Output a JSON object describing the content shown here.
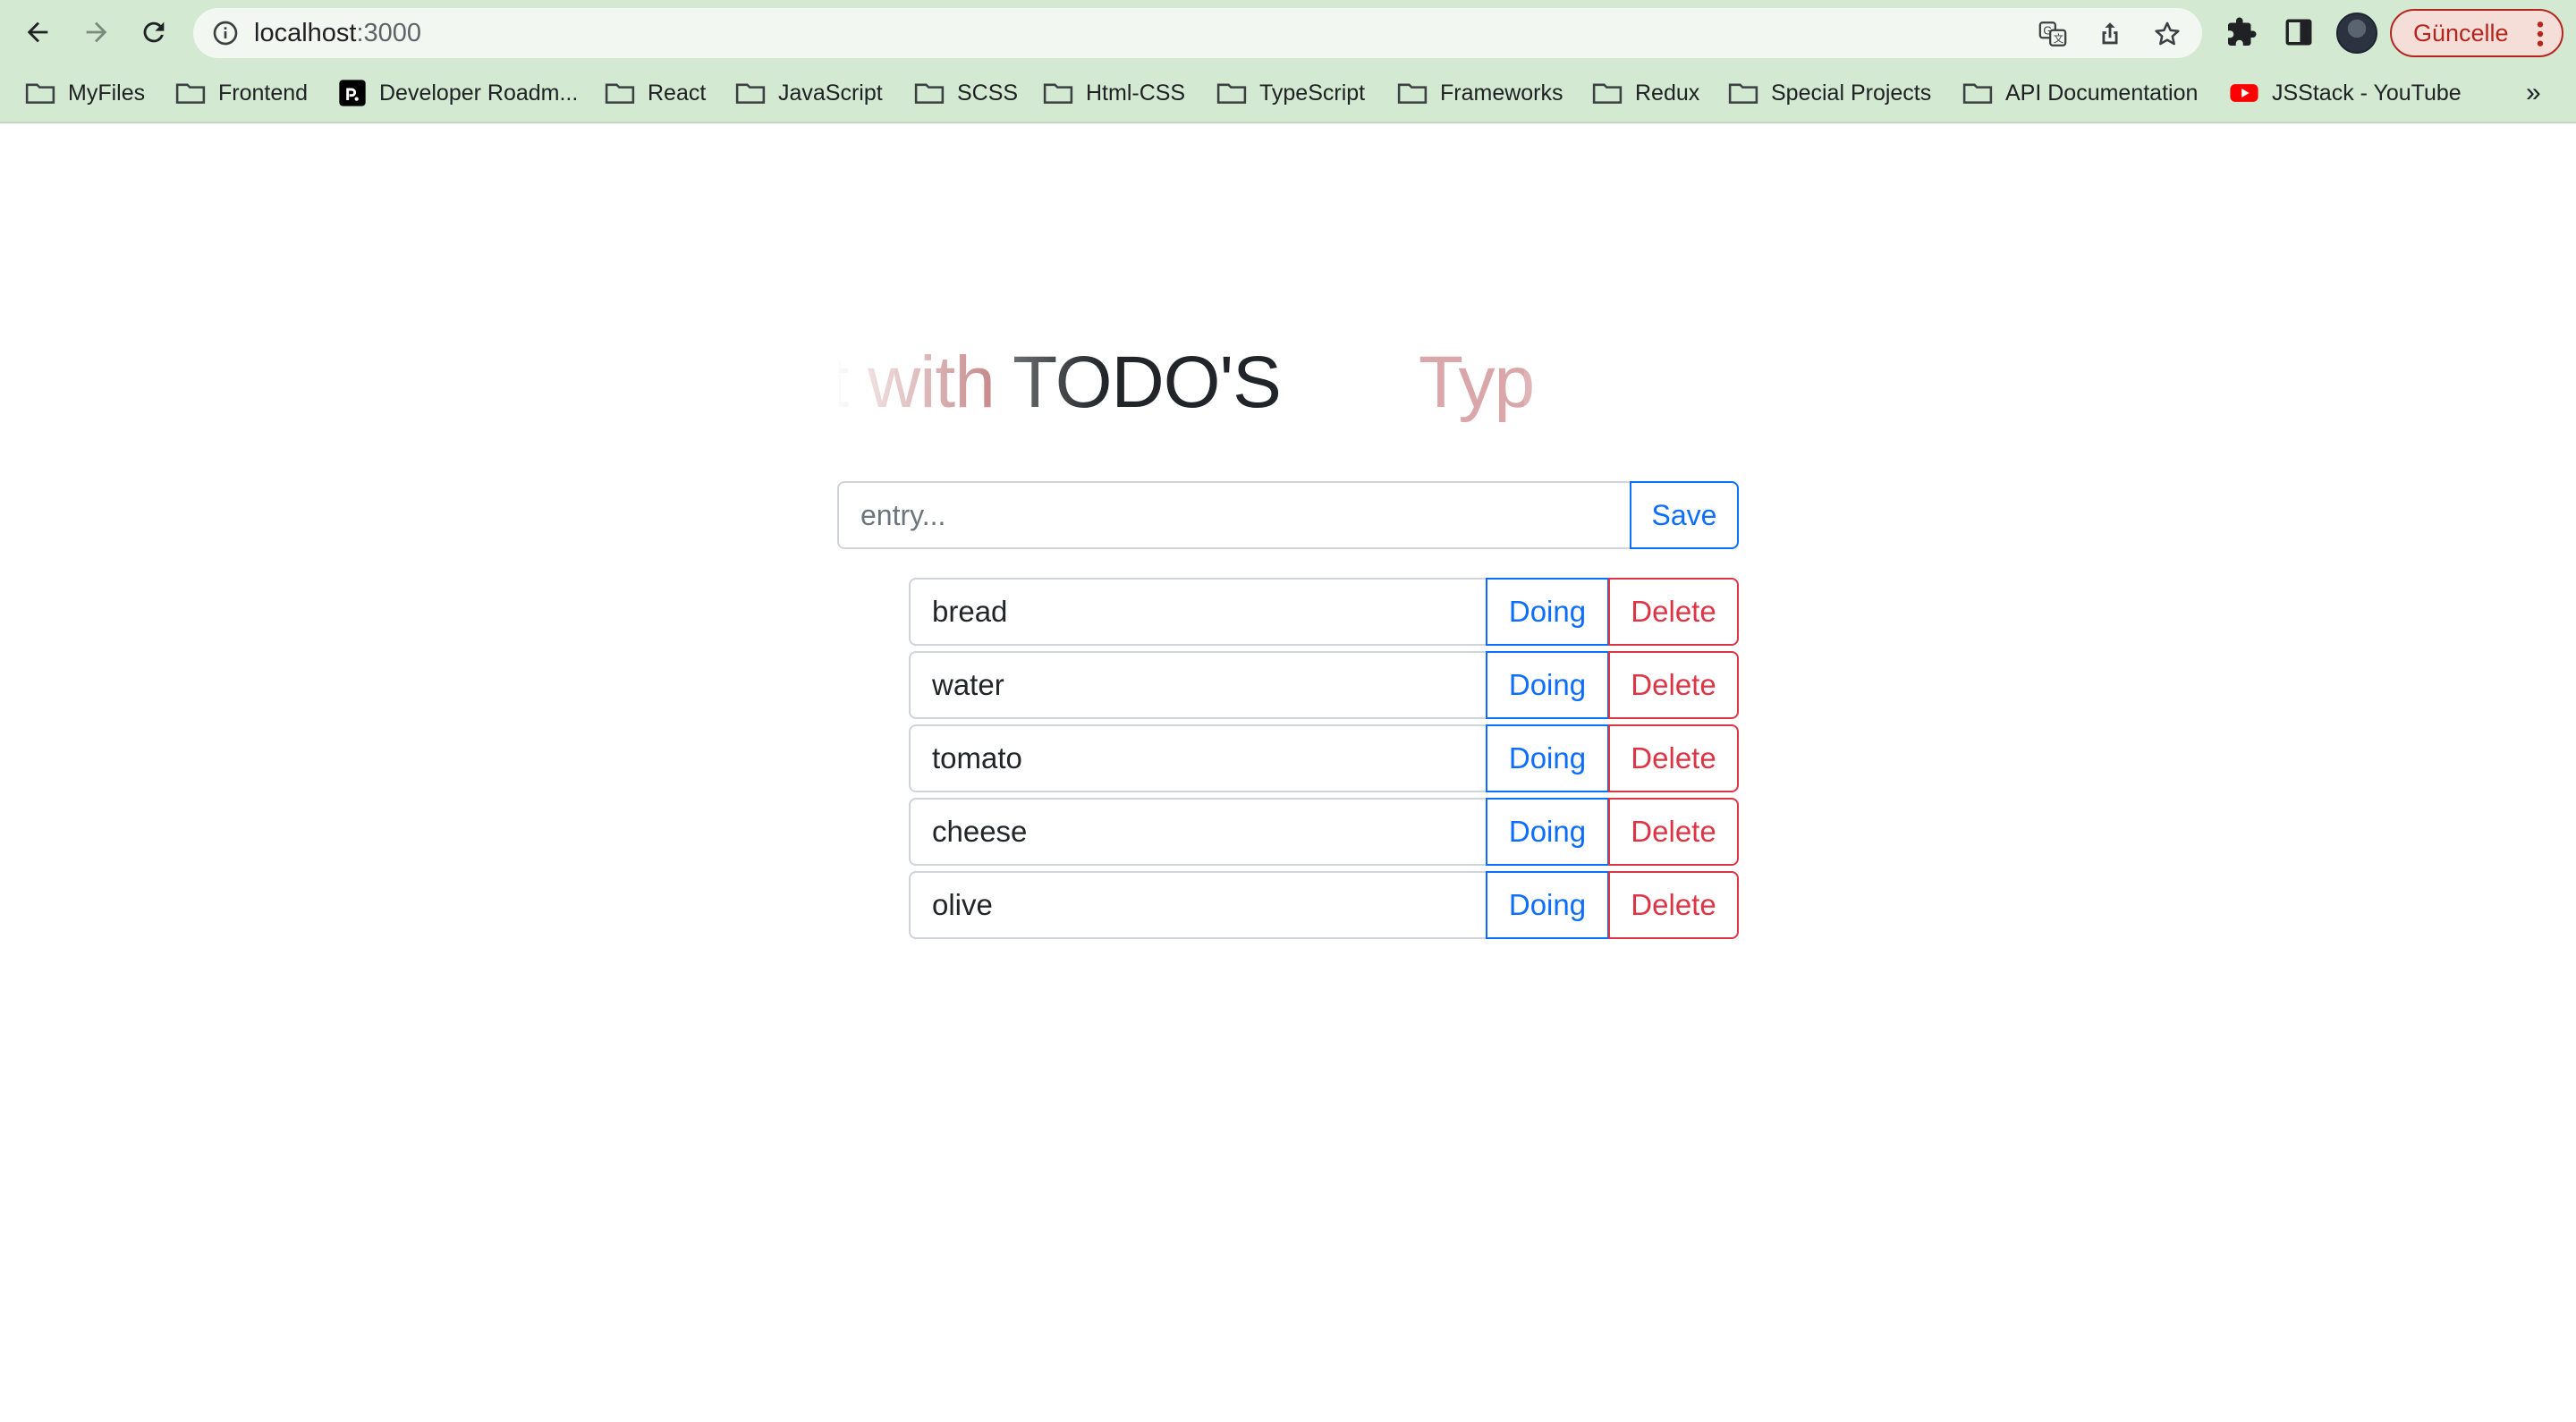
{
  "browser": {
    "url_host": "localhost",
    "url_port": ":3000",
    "update_label": "Güncelle",
    "icons": [
      "back-icon",
      "forward-icon",
      "reload-icon",
      "info-icon",
      "translate-icon",
      "share-icon",
      "star-icon",
      "extensions-icon",
      "side-panel-icon",
      "profile-avatar",
      "more-vert-icon"
    ]
  },
  "bookmarks": {
    "items": [
      {
        "label": "MyFiles",
        "icon": "folder-icon"
      },
      {
        "label": "Frontend",
        "icon": "folder-icon"
      },
      {
        "label": "Developer Roadm...",
        "icon": "roadmap-logo-icon"
      },
      {
        "label": "React",
        "icon": "folder-icon"
      },
      {
        "label": "JavaScript",
        "icon": "folder-icon"
      },
      {
        "label": "SCSS",
        "icon": "folder-icon"
      },
      {
        "label": "Html-CSS",
        "icon": "folder-icon"
      },
      {
        "label": "TypeScript",
        "icon": "folder-icon"
      },
      {
        "label": "Frameworks",
        "icon": "folder-icon"
      },
      {
        "label": "Redux",
        "icon": "folder-icon"
      },
      {
        "label": "Special Projects",
        "icon": "folder-icon"
      },
      {
        "label": "API Documentation",
        "icon": "folder-icon"
      },
      {
        "label": "JSStack - YouTube",
        "icon": "youtube-icon"
      }
    ],
    "more": "»"
  },
  "marquee": {
    "part_a": "eScript ",
    "part_b": "with ",
    "part_c": "TODO'S",
    "part_d": "Typ"
  },
  "entry": {
    "placeholder": "entry...",
    "value": "",
    "save_label": "Save"
  },
  "todos": [
    {
      "text": "bread",
      "doing_label": "Doing",
      "delete_label": "Delete"
    },
    {
      "text": "water",
      "doing_label": "Doing",
      "delete_label": "Delete"
    },
    {
      "text": "tomato",
      "doing_label": "Doing",
      "delete_label": "Delete"
    },
    {
      "text": "cheese",
      "doing_label": "Doing",
      "delete_label": "Delete"
    },
    {
      "text": "olive",
      "doing_label": "Doing",
      "delete_label": "Delete"
    }
  ],
  "colors": {
    "chrome_bg": "#d3e9d2",
    "primary": "#0d6efd",
    "danger": "#dc3545",
    "marquee_accent": "#a03a3e"
  }
}
